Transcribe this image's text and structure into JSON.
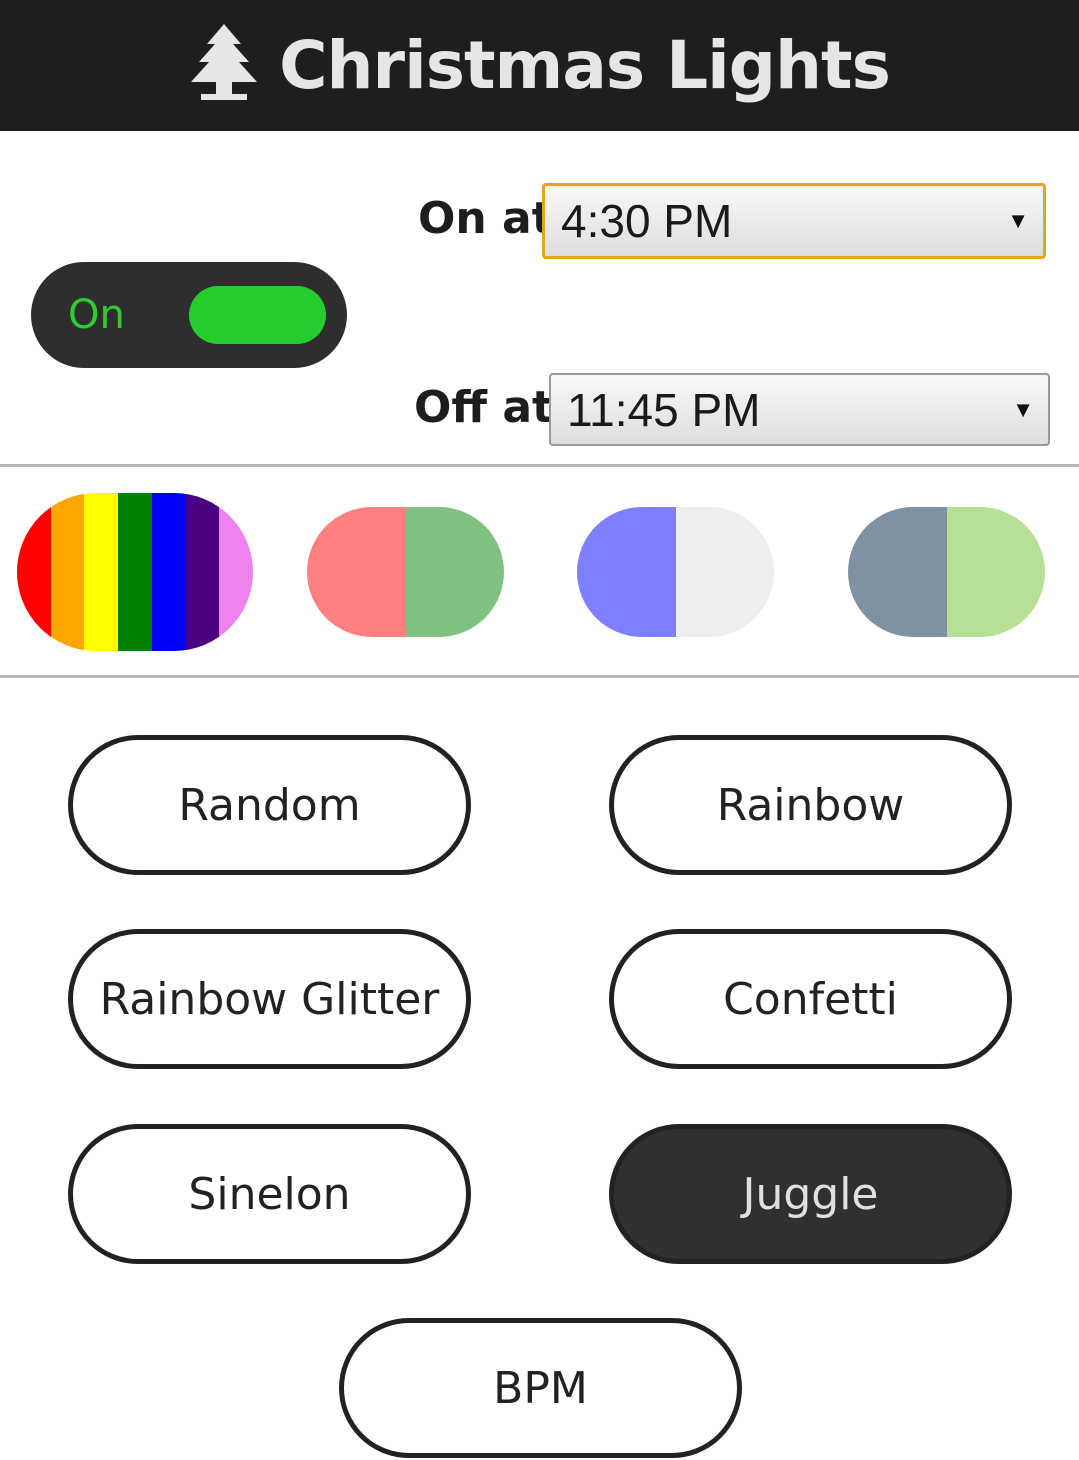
{
  "header": {
    "title": "Christmas Lights",
    "icon": "tree-icon"
  },
  "schedule": {
    "on_label": "On at",
    "on_value": "4:30 PM",
    "off_label": "Off at",
    "off_value": "11:45 PM",
    "arrow": "▼"
  },
  "power_toggle": {
    "label": "On",
    "state": "on",
    "color": "#25cc2d"
  },
  "palettes": [
    {
      "name": "rainbow",
      "colors": [
        "#ff0000",
        "#ffa500",
        "#ffff00",
        "#008000",
        "#0000ff",
        "#4b0082",
        "#ee82ee"
      ]
    },
    {
      "name": "red-green",
      "colors": [
        "#ff8080",
        "#80c080"
      ]
    },
    {
      "name": "blue-white",
      "colors": [
        "#8080ff",
        "#eeeeee"
      ]
    },
    {
      "name": "slate-lime",
      "colors": [
        "#8092a2",
        "#b5e095"
      ]
    }
  ],
  "modes": [
    {
      "label": "Random",
      "active": false
    },
    {
      "label": "Rainbow",
      "active": false
    },
    {
      "label": "Rainbow Glitter",
      "active": false
    },
    {
      "label": "Confetti",
      "active": false
    },
    {
      "label": "Sinelon",
      "active": false
    },
    {
      "label": "Juggle",
      "active": true
    },
    {
      "label": "BPM",
      "active": false
    }
  ]
}
